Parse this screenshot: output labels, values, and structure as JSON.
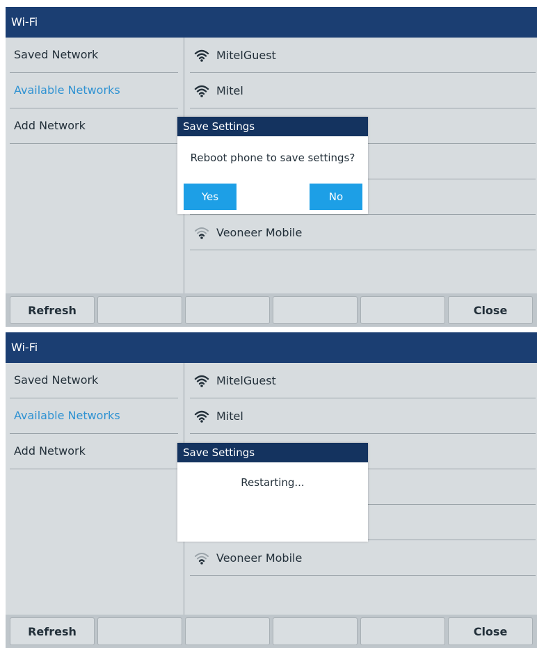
{
  "screens": [
    {
      "title": "Wi-Fi",
      "menu": [
        {
          "label": "Saved Network",
          "active": false
        },
        {
          "label": "Available Networks",
          "active": true
        },
        {
          "label": "Add Network",
          "active": false
        }
      ],
      "networks": [
        {
          "name": "MitelGuest",
          "signal": "strong"
        },
        {
          "name": "Mitel",
          "signal": "strong"
        },
        {
          "name": "",
          "signal": ""
        },
        {
          "name": "",
          "signal": ""
        },
        {
          "name": "",
          "signal": ""
        },
        {
          "name": "Veoneer Mobile",
          "signal": "weak"
        }
      ],
      "softkeys": [
        "Refresh",
        "",
        "",
        "",
        "",
        "Close"
      ],
      "dialog": {
        "title": "Save Settings",
        "message": "Reboot phone to save settings?",
        "yes_label": "Yes",
        "no_label": "No"
      }
    },
    {
      "title": "Wi-Fi",
      "menu": [
        {
          "label": "Saved Network",
          "active": false
        },
        {
          "label": "Available Networks",
          "active": true
        },
        {
          "label": "Add Network",
          "active": false
        }
      ],
      "networks": [
        {
          "name": "MitelGuest",
          "signal": "strong"
        },
        {
          "name": "Mitel",
          "signal": "strong"
        },
        {
          "name": "",
          "signal": ""
        },
        {
          "name": "",
          "signal": ""
        },
        {
          "name": "",
          "signal": ""
        },
        {
          "name": "Veoneer Mobile",
          "signal": "weak"
        }
      ],
      "softkeys": [
        "Refresh",
        "",
        "",
        "",
        "",
        "Close"
      ],
      "dialog": {
        "title": "Save Settings",
        "message": "Restarting..."
      }
    }
  ],
  "colors": {
    "titlebar": "#1b3e72",
    "dialog_title": "#14335f",
    "accent": "#2f92d2",
    "button": "#1d9fe6",
    "background": "#d7dcdf"
  }
}
